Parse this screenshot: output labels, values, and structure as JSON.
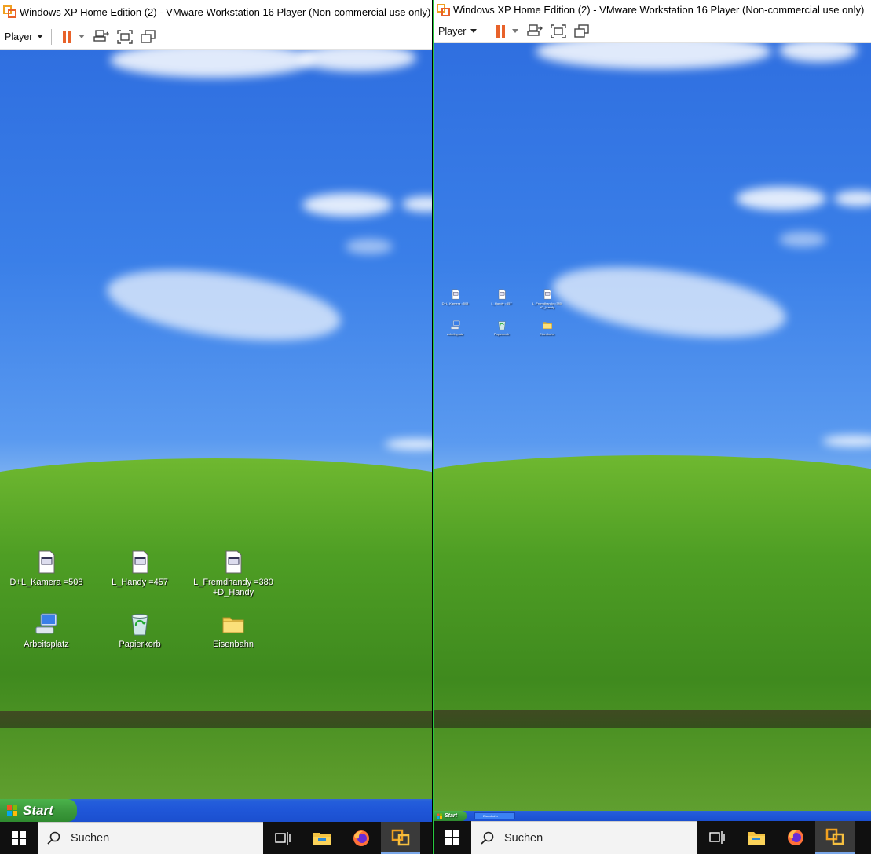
{
  "window": {
    "title": "Windows XP Home Edition (2) - VMware Workstation 16 Player (Non-commercial use only)"
  },
  "toolbar": {
    "player_label": "Player",
    "icons": [
      "pause-icon",
      "send-ctrl-alt-del-icon",
      "full-screen-icon",
      "unity-icon"
    ]
  },
  "desktop": {
    "icons": [
      {
        "label": "D+L_Kamera =508",
        "icon": "text-document-icon"
      },
      {
        "label": "L_Handy =457",
        "icon": "text-document-icon"
      },
      {
        "label": "L_Fremdhandy =380 +D_Handy",
        "icon": "text-document-icon"
      },
      {
        "label": "Arbeitsplatz",
        "icon": "my-computer-icon"
      },
      {
        "label": "Papierkorb",
        "icon": "recycle-bin-icon"
      },
      {
        "label": "Eisenbahn",
        "icon": "folder-icon"
      }
    ]
  },
  "xp_taskbar": {
    "start_label": "Start",
    "task_label": "Eisenbahn"
  },
  "windows_taskbar": {
    "search_placeholder": "Suchen",
    "apps": [
      "task-view-icon",
      "file-explorer-icon",
      "firefox-icon",
      "vmware-player-icon"
    ]
  },
  "colors": {
    "vmware_orange": "#e8622a",
    "xp_taskbar_blue": "#245edb",
    "xp_start_green": "#3c9a3c",
    "divider_green": "#27c93f"
  }
}
